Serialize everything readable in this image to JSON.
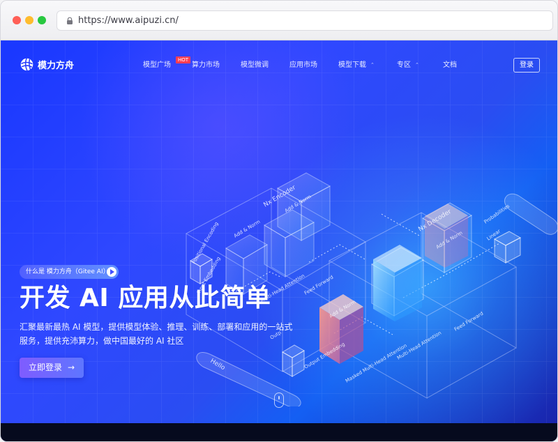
{
  "browser": {
    "url": "https://www.aipuzi.cn/"
  },
  "site": {
    "brand": "模力方舟",
    "nav": [
      {
        "label": "模型广场",
        "badge": "HOT"
      },
      {
        "label": "算力市场"
      },
      {
        "label": "模型微调"
      },
      {
        "label": "应用市场"
      },
      {
        "label": "模型下载",
        "icon": "chevron-down"
      },
      {
        "label": "专区",
        "icon": "chevron-down"
      },
      {
        "label": "文档"
      }
    ],
    "login_label": "登录"
  },
  "hero": {
    "pill": "什么是 模力方舟（Gitee AI）",
    "title": "开发 AI 应用从此简单",
    "subtitle": "汇聚最新最热 AI 模型，提供模型体验、推理、训练、部署和应用的一站式服务，提供充沛算力，做中国最好的 AI 社区",
    "cta": "立即登录"
  },
  "illustration": {
    "encoder_label": "Nx Encoder",
    "decoder_label": "Nx Decoder",
    "encoder_labels": [
      "Add & Norm",
      "Feed Forward",
      "Add & Norm",
      "Multi-Head Attention",
      "Positional Encoding",
      "Input Embedding"
    ],
    "decoder_labels": [
      "Add & Norm",
      "Feed Forward",
      "Add & Norm",
      "Multi-Head Attention",
      "Masked Multi-Head Attention",
      "Output Embedding"
    ],
    "outputs": [
      "Probabilities",
      "Linear"
    ],
    "input_word": "Hello",
    "output_word": "Outp"
  },
  "colors": {
    "hero_blue": "#1937ff",
    "accent_cyan": "#48bcff",
    "cta_purple": "#7f5cff",
    "hot_red": "#ff3e53"
  }
}
